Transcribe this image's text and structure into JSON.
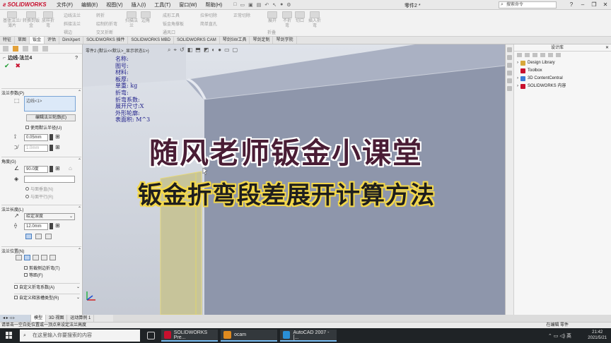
{
  "app": {
    "brand": "SOLIDWORKS",
    "doc_title": "零件2 *",
    "search_placeholder": "搜索命令"
  },
  "menu": [
    "文件(F)",
    "编辑(E)",
    "视图(V)",
    "插入(I)",
    "工具(T)",
    "窗口(W)",
    "帮助(H)"
  ],
  "ribbon": [
    "基体法兰/薄片",
    "转换到钣金",
    "放样折弯",
    "边线法兰",
    "斜接法兰",
    "褶边",
    "转折",
    "绘制的折弯",
    "交叉折断",
    "扫描法兰",
    "边角",
    "成形工具",
    "钣金角撑板",
    "通风口",
    "拉伸切除",
    "简单直孔",
    "正常切除",
    "展开",
    "折叠",
    "不折弯",
    "切口",
    "插入折弯"
  ],
  "tabs": [
    "特征",
    "草图",
    "钣金",
    "评估",
    "DimXpert",
    "SOLIDWORKS 插件",
    "SOLIDWORKS MBD",
    "SOLIDWORKS CAM",
    "琴剑SW工具",
    "琴剑定制",
    "琴剑学院"
  ],
  "property_manager": {
    "title": "边线-法兰4",
    "help": "?",
    "flange_params": {
      "header": "法兰参数(P)",
      "edge_list": "边线<1>",
      "edit_profile_button": "编辑法兰轮廓(E)",
      "use_default_radius": "使用默认半径(U)",
      "radius": "0.05mm",
      "gap": "1.0mm"
    },
    "angle": {
      "header": "角度(G)",
      "value": "90.0度",
      "perpendicular": "与面垂直(N)",
      "parallel": "与面平行(R)"
    },
    "flange_length": {
      "header": "法兰长度(L)",
      "end_condition": "给定深度",
      "value": "12.0mm"
    },
    "flange_position": {
      "header": "法兰位置(N)",
      "trim_side_bends": "剪裁侧边折弯(T)",
      "offset": "等距(F)"
    },
    "custom_bend_allowance": "自定义折弯系数(A)",
    "custom_relief": "自定义释放槽类型(R)"
  },
  "graphics": {
    "viewport_title": "零件2 (默认<<默认>_显示状态1>)",
    "property_labels": [
      "名称:",
      "图号:",
      "材料:",
      "板厚:",
      "单重: kg",
      "折弯:",
      "折弯系数:",
      "展开尺寸:X",
      "外形轮廓:",
      "表面积: M^3"
    ],
    "overlay_title": "随风老师钣金小课堂",
    "overlay_subtitle": "钣金折弯段差展开计算方法",
    "view_tabs": [
      "模型",
      "3D 视图",
      "运动算例 1"
    ]
  },
  "task_pane": {
    "title": "设计库",
    "items": [
      {
        "label": "Design Library",
        "color": "#d7a83b"
      },
      {
        "label": "Toolbox",
        "color": "#c8102e"
      },
      {
        "label": "3D ContentCentral",
        "color": "#3b7bd7"
      },
      {
        "label": "SOLIDWORKS 内容",
        "color": "#c8102e"
      }
    ]
  },
  "status_bar": {
    "message": "请单击一空白处位置或一顶点来设定法兰高度",
    "editing": "在编辑 零件"
  },
  "taskbar": {
    "search_placeholder": "在这里输入你要搜索的内容",
    "apps": [
      {
        "label": "SOLIDWORKS Pre...",
        "color": "#c8102e"
      },
      {
        "label": "ocam",
        "color": "#e08a1e"
      },
      {
        "label": "AutoCAD 2007 - [...",
        "color": "#2a8fd6"
      }
    ],
    "time": "21:42",
    "date": "2021/5/21",
    "ime": "英"
  }
}
